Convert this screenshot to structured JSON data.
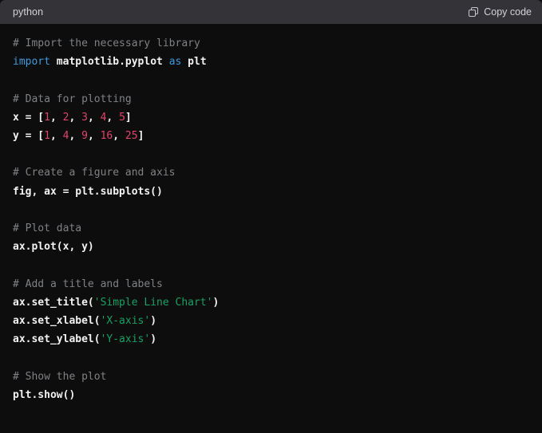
{
  "header": {
    "language_label": "python",
    "copy_label": "Copy code",
    "copy_icon": "copy-icon"
  },
  "colors": {
    "header_bg": "#343438",
    "code_bg": "#0d0d0d",
    "comment": "#7f8185",
    "keyword": "#3d9ade",
    "plain": "#f2f2f2",
    "number": "#e0446b",
    "string": "#17a065",
    "header_text": "#d2d2d8"
  },
  "code": {
    "language": "python",
    "lines": [
      {
        "id": "l1",
        "tokens": [
          {
            "t": "# Import the necessary library",
            "c": "comment"
          }
        ]
      },
      {
        "id": "l2",
        "tokens": [
          {
            "t": "import",
            "c": "keyword"
          },
          {
            "t": " ",
            "c": "plain"
          },
          {
            "t": "matplotlib.pyplot",
            "c": "plain"
          },
          {
            "t": " ",
            "c": "plain"
          },
          {
            "t": "as",
            "c": "keyword"
          },
          {
            "t": " ",
            "c": "plain"
          },
          {
            "t": "plt",
            "c": "plain"
          }
        ]
      },
      {
        "id": "l3",
        "tokens": []
      },
      {
        "id": "l4",
        "tokens": [
          {
            "t": "# Data for plotting",
            "c": "comment"
          }
        ]
      },
      {
        "id": "l5",
        "tokens": [
          {
            "t": "x = [",
            "c": "plain"
          },
          {
            "t": "1",
            "c": "number"
          },
          {
            "t": ", ",
            "c": "punct"
          },
          {
            "t": "2",
            "c": "number"
          },
          {
            "t": ", ",
            "c": "punct"
          },
          {
            "t": "3",
            "c": "number"
          },
          {
            "t": ", ",
            "c": "punct"
          },
          {
            "t": "4",
            "c": "number"
          },
          {
            "t": ", ",
            "c": "punct"
          },
          {
            "t": "5",
            "c": "number"
          },
          {
            "t": "]",
            "c": "plain"
          }
        ]
      },
      {
        "id": "l6",
        "tokens": [
          {
            "t": "y = [",
            "c": "plain"
          },
          {
            "t": "1",
            "c": "number"
          },
          {
            "t": ", ",
            "c": "punct"
          },
          {
            "t": "4",
            "c": "number"
          },
          {
            "t": ", ",
            "c": "punct"
          },
          {
            "t": "9",
            "c": "number"
          },
          {
            "t": ", ",
            "c": "punct"
          },
          {
            "t": "16",
            "c": "number"
          },
          {
            "t": ", ",
            "c": "punct"
          },
          {
            "t": "25",
            "c": "number"
          },
          {
            "t": "]",
            "c": "plain"
          }
        ]
      },
      {
        "id": "l7",
        "tokens": []
      },
      {
        "id": "l8",
        "tokens": [
          {
            "t": "# Create a figure and axis",
            "c": "comment"
          }
        ]
      },
      {
        "id": "l9",
        "tokens": [
          {
            "t": "fig, ax = plt.subplots()",
            "c": "plain"
          }
        ]
      },
      {
        "id": "l10",
        "tokens": []
      },
      {
        "id": "l11",
        "tokens": [
          {
            "t": "# Plot data",
            "c": "comment"
          }
        ]
      },
      {
        "id": "l12",
        "tokens": [
          {
            "t": "ax.plot(x, y)",
            "c": "plain"
          }
        ]
      },
      {
        "id": "l13",
        "tokens": []
      },
      {
        "id": "l14",
        "tokens": [
          {
            "t": "# Add a title and labels",
            "c": "comment"
          }
        ]
      },
      {
        "id": "l15",
        "tokens": [
          {
            "t": "ax.set_title(",
            "c": "plain"
          },
          {
            "t": "'Simple Line Chart'",
            "c": "string"
          },
          {
            "t": ")",
            "c": "plain"
          }
        ]
      },
      {
        "id": "l16",
        "tokens": [
          {
            "t": "ax.set_xlabel(",
            "c": "plain"
          },
          {
            "t": "'X-axis'",
            "c": "string"
          },
          {
            "t": ")",
            "c": "plain"
          }
        ]
      },
      {
        "id": "l17",
        "tokens": [
          {
            "t": "ax.set_ylabel(",
            "c": "plain"
          },
          {
            "t": "'Y-axis'",
            "c": "string"
          },
          {
            "t": ")",
            "c": "plain"
          }
        ]
      },
      {
        "id": "l18",
        "tokens": []
      },
      {
        "id": "l19",
        "tokens": [
          {
            "t": "# Show the plot",
            "c": "comment"
          }
        ]
      },
      {
        "id": "l20",
        "tokens": [
          {
            "t": "plt.show()",
            "c": "plain"
          }
        ]
      }
    ]
  }
}
